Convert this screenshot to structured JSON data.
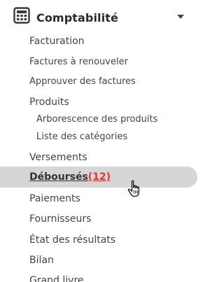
{
  "menu": {
    "title": "Comptabilité",
    "header_icon": "calculator-icon",
    "toggle_icon": "chevron-down-icon",
    "items": [
      {
        "label": "Facturation"
      },
      {
        "label": "Factures à renouveler"
      },
      {
        "label": "Approuver des factures"
      },
      {
        "label": "Produits"
      },
      {
        "label": "Arborescence des produits"
      },
      {
        "label": "Liste des catégories"
      },
      {
        "label": "Versements"
      },
      {
        "label": "Déboursés",
        "badge": "(12)"
      },
      {
        "label": "Paiements"
      },
      {
        "label": "Fournisseurs"
      },
      {
        "label": "État des résultats"
      },
      {
        "label": "Bilan"
      },
      {
        "label": "Grand livre"
      }
    ],
    "active_index": 7
  },
  "colors": {
    "active_background": "#d6d6d6",
    "badge": "#d23a3a",
    "text": "#444444"
  },
  "cursor_icon": "hand-pointer-icon"
}
